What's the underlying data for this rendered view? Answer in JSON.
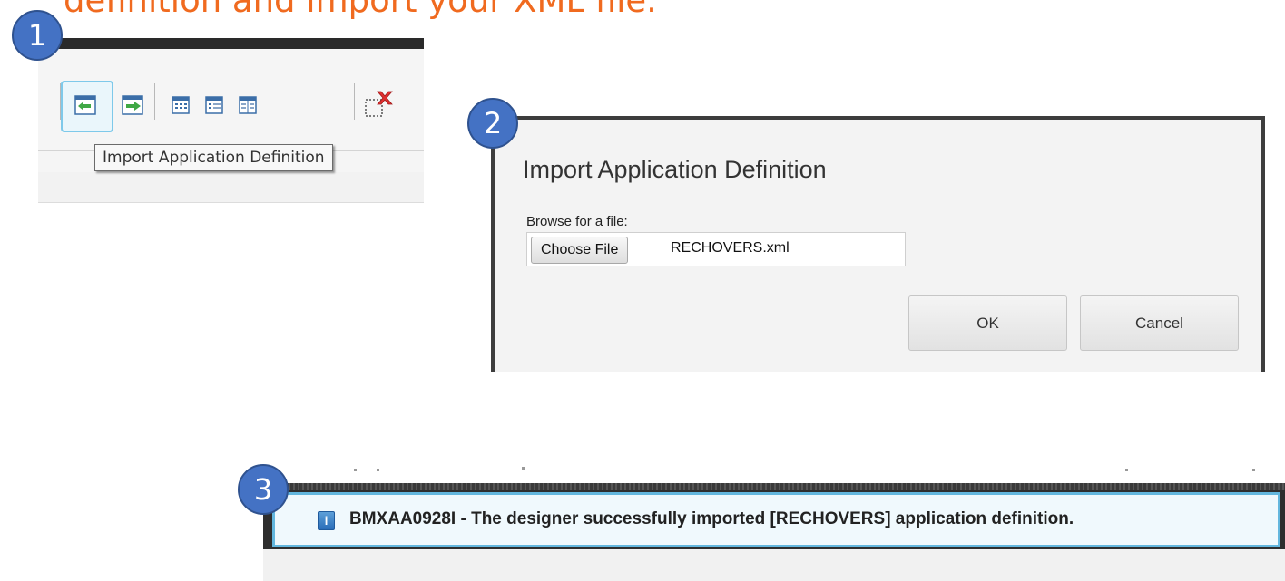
{
  "heading": "definition and import your XML file.",
  "steps": [
    "1",
    "2",
    "3"
  ],
  "toolbar": {
    "tooltip": "Import Application Definition",
    "icons": [
      "import-app-definition-icon",
      "export-app-definition-icon",
      "table-icon",
      "section-icon",
      "columns-icon",
      "delete-icon"
    ]
  },
  "dialog": {
    "title": "Import Application Definition",
    "browse_label": "Browse for a file:",
    "choose_file_label": "Choose File",
    "file_name": "RECHOVERS.xml",
    "ok_label": "OK",
    "cancel_label": "Cancel"
  },
  "message": {
    "icon": "info-icon",
    "icon_glyph": "i",
    "text": "BMXAA0928I - The designer successfully imported [RECHOVERS] application definition."
  },
  "colors": {
    "heading": "#f06a1f",
    "step_badge": "#4472c4",
    "hover_border": "#7ec9ea",
    "message_border": "#63b7de"
  }
}
